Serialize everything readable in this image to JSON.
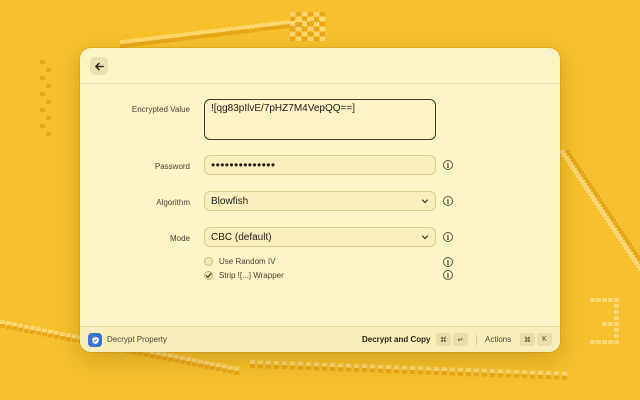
{
  "background": {
    "color": "#f7c02c"
  },
  "window": {
    "back_icon": "arrow-left-icon"
  },
  "form": {
    "encrypted_value": {
      "label": "Encrypted Value",
      "value": "![qg83pIlvE/7pHZ7M4VepQQ==]"
    },
    "password": {
      "label": "Password",
      "value": "••••••••••••••"
    },
    "algorithm": {
      "label": "Algorithm",
      "value": "Blowfish"
    },
    "mode": {
      "label": "Mode",
      "value": "CBC (default)"
    },
    "use_random_iv": {
      "label": "Use Random IV",
      "checked": false
    },
    "strip_wrapper": {
      "label": "Strip ![...] Wrapper",
      "checked": true
    },
    "info_glyph": "i"
  },
  "footer": {
    "title": "Decrypt Property",
    "primary_action": "Decrypt and Copy",
    "primary_shortcut": [
      "⌘",
      "↵"
    ],
    "actions_label": "Actions",
    "actions_shortcut": [
      "⌘",
      "K"
    ],
    "accent": "#3e6fd8"
  }
}
